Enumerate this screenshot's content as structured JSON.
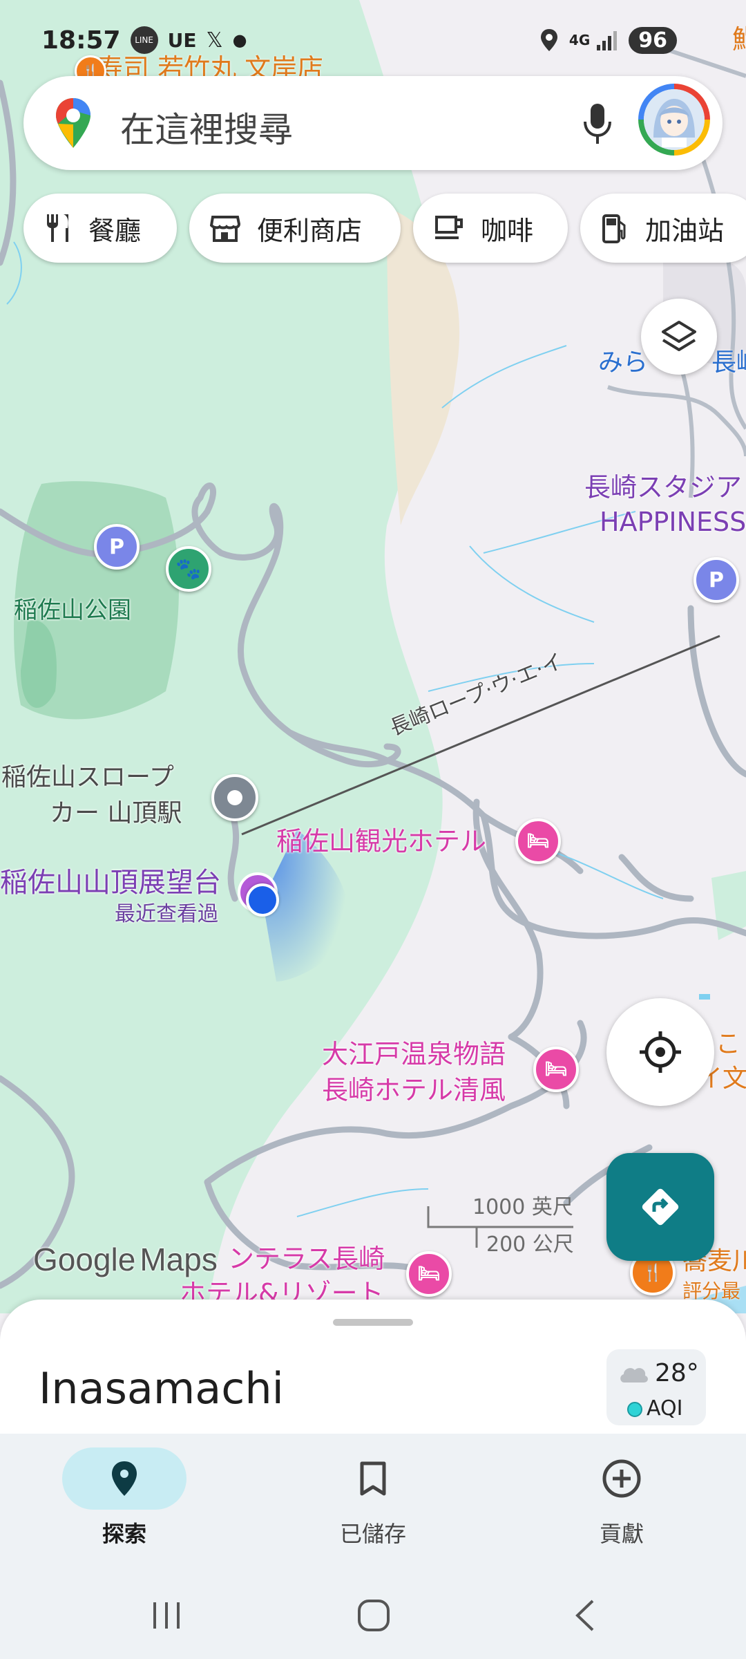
{
  "status_bar": {
    "time": "18:57",
    "line": "LINE",
    "ue": "UE",
    "x": "𝕏",
    "network": "4G",
    "battery": "96",
    "edge_text": "鮨"
  },
  "search": {
    "placeholder": "在這裡搜尋"
  },
  "chips": [
    {
      "label": "餐廳",
      "icon": "fork-knife-icon"
    },
    {
      "label": "便利商店",
      "icon": "store-icon"
    },
    {
      "label": "咖啡",
      "icon": "coffee-icon"
    },
    {
      "label": "加油站",
      "icon": "gas-station-icon"
    }
  ],
  "map": {
    "top_restaurant": "寿司 若竹丸 文岸店",
    "park": "稲佐山公園",
    "ropeway_station": [
      "稲佐山スロープ",
      "カー 山頂駅"
    ],
    "observatory": "稲佐山山頂展望台",
    "observatory_sub": "最近查看過",
    "ropeway_line": "長崎ロープ·ウ·エ·イ",
    "hotel1": "稲佐山観光ホテル",
    "hotel2": [
      "大江戸温泉物語",
      "長崎ホテル清風"
    ],
    "hotel3": [
      "ンテラス長崎",
      "ホテル&リゾート"
    ],
    "stadium": [
      "長崎スタジア",
      "HAPPINESS"
    ],
    "mira": "みら",
    "mira2": "長崎",
    "right_edge1": "いこ",
    "right_edge2": "イ文",
    "soba": "蕎麦川",
    "soba_sub": "評分最",
    "scale_ft": "1000 英尺",
    "scale_m": "200 公尺",
    "google": "Google",
    "maps": "Maps",
    "parking": "P",
    "colors": {
      "park_green": "#cdeedd",
      "road": "#aeb6c1",
      "hotel_pink": "#ea4aa6",
      "water": "#7fd0f0",
      "directions_teal": "#0f7d86"
    }
  },
  "sheet": {
    "place": "Inasamachi",
    "temp": "28°",
    "aqi": "AQI"
  },
  "nav": {
    "items": [
      {
        "label": "探索",
        "icon": "location-pin-icon"
      },
      {
        "label": "已儲存",
        "icon": "bookmark-icon"
      },
      {
        "label": "貢獻",
        "icon": "add-circle-icon"
      }
    ]
  }
}
